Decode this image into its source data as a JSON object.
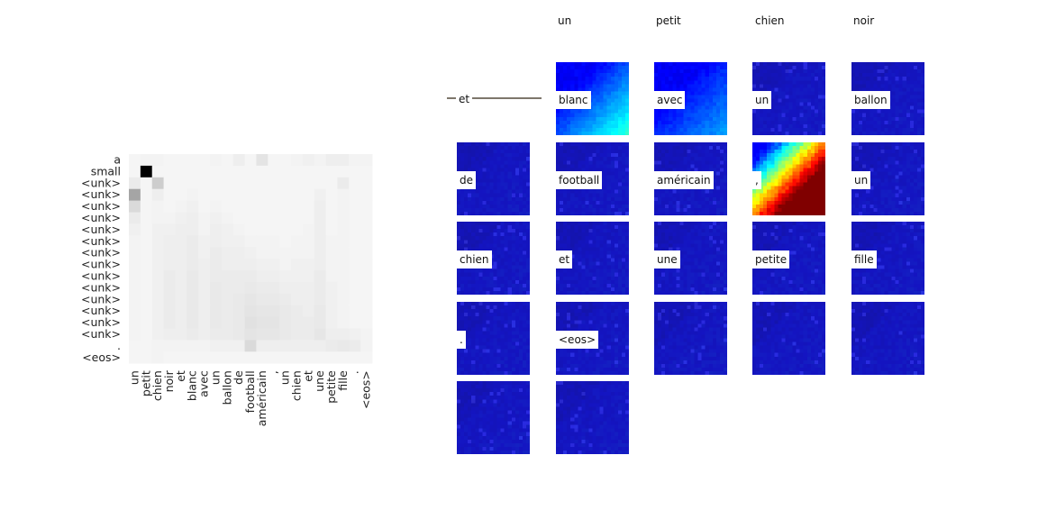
{
  "chart_data": [
    {
      "type": "heatmap",
      "title": "",
      "y_tokens": [
        "a",
        "small",
        "<unk>",
        "<unk>",
        "<unk>",
        "<unk>",
        "<unk>",
        "<unk>",
        "<unk>",
        "<unk>",
        "<unk>",
        "<unk>",
        "<unk>",
        "<unk>",
        "<unk>",
        "<unk>",
        ".",
        "<eos>"
      ],
      "x_tokens": [
        "un",
        "petit",
        "chien",
        "noir",
        "et",
        "blanc",
        "avec",
        "un",
        "ballon",
        "de",
        "football",
        "américain",
        ",",
        "un",
        "chien",
        "et",
        "une",
        "petite",
        "fille",
        ".",
        "<eos>"
      ],
      "colormap": "greys",
      "value_range": [
        0,
        1
      ],
      "values": [
        [
          0.02,
          0.03,
          0.03,
          0.02,
          0.02,
          0.02,
          0.02,
          0.03,
          0.02,
          0.05,
          0.02,
          0.09,
          0.02,
          0.02,
          0.03,
          0.04,
          0.03,
          0.05,
          0.05,
          0.03,
          0.03
        ],
        [
          0.02,
          1.0,
          0.02,
          0.02,
          0.02,
          0.02,
          0.02,
          0.02,
          0.02,
          0.02,
          0.02,
          0.02,
          0.02,
          0.02,
          0.02,
          0.02,
          0.02,
          0.02,
          0.02,
          0.02,
          0.02
        ],
        [
          0.06,
          0.02,
          0.18,
          0.02,
          0.02,
          0.02,
          0.02,
          0.02,
          0.02,
          0.02,
          0.02,
          0.02,
          0.02,
          0.02,
          0.02,
          0.02,
          0.02,
          0.02,
          0.06,
          0.02,
          0.02
        ],
        [
          0.34,
          0.02,
          0.05,
          0.02,
          0.02,
          0.03,
          0.02,
          0.02,
          0.02,
          0.02,
          0.02,
          0.02,
          0.02,
          0.02,
          0.02,
          0.02,
          0.04,
          0.02,
          0.03,
          0.02,
          0.02
        ],
        [
          0.13,
          0.02,
          0.03,
          0.02,
          0.03,
          0.04,
          0.02,
          0.03,
          0.02,
          0.02,
          0.02,
          0.02,
          0.02,
          0.02,
          0.02,
          0.02,
          0.05,
          0.02,
          0.03,
          0.02,
          0.02
        ],
        [
          0.06,
          0.02,
          0.03,
          0.03,
          0.04,
          0.05,
          0.03,
          0.04,
          0.03,
          0.02,
          0.02,
          0.02,
          0.02,
          0.02,
          0.02,
          0.02,
          0.05,
          0.02,
          0.03,
          0.02,
          0.02
        ],
        [
          0.04,
          0.02,
          0.04,
          0.04,
          0.05,
          0.05,
          0.03,
          0.05,
          0.04,
          0.03,
          0.02,
          0.02,
          0.02,
          0.02,
          0.02,
          0.03,
          0.05,
          0.02,
          0.03,
          0.02,
          0.02
        ],
        [
          0.03,
          0.02,
          0.04,
          0.05,
          0.05,
          0.06,
          0.04,
          0.05,
          0.04,
          0.04,
          0.03,
          0.03,
          0.03,
          0.02,
          0.03,
          0.03,
          0.05,
          0.03,
          0.03,
          0.02,
          0.02
        ],
        [
          0.03,
          0.02,
          0.04,
          0.05,
          0.05,
          0.06,
          0.04,
          0.06,
          0.05,
          0.05,
          0.04,
          0.03,
          0.03,
          0.03,
          0.03,
          0.03,
          0.05,
          0.03,
          0.03,
          0.02,
          0.02
        ],
        [
          0.03,
          0.02,
          0.04,
          0.05,
          0.05,
          0.06,
          0.05,
          0.06,
          0.05,
          0.05,
          0.05,
          0.04,
          0.04,
          0.03,
          0.04,
          0.04,
          0.05,
          0.03,
          0.03,
          0.02,
          0.02
        ],
        [
          0.03,
          0.02,
          0.04,
          0.06,
          0.05,
          0.07,
          0.05,
          0.06,
          0.06,
          0.06,
          0.06,
          0.05,
          0.05,
          0.04,
          0.04,
          0.04,
          0.06,
          0.03,
          0.03,
          0.02,
          0.02
        ],
        [
          0.03,
          0.02,
          0.04,
          0.06,
          0.05,
          0.07,
          0.05,
          0.07,
          0.06,
          0.06,
          0.07,
          0.06,
          0.06,
          0.05,
          0.05,
          0.05,
          0.06,
          0.04,
          0.03,
          0.02,
          0.02
        ],
        [
          0.03,
          0.02,
          0.04,
          0.06,
          0.05,
          0.07,
          0.05,
          0.07,
          0.06,
          0.07,
          0.08,
          0.07,
          0.07,
          0.06,
          0.05,
          0.05,
          0.06,
          0.04,
          0.03,
          0.02,
          0.02
        ],
        [
          0.03,
          0.02,
          0.04,
          0.06,
          0.05,
          0.07,
          0.05,
          0.07,
          0.06,
          0.07,
          0.09,
          0.08,
          0.08,
          0.07,
          0.06,
          0.05,
          0.07,
          0.04,
          0.03,
          0.02,
          0.02
        ],
        [
          0.03,
          0.02,
          0.04,
          0.06,
          0.05,
          0.07,
          0.05,
          0.07,
          0.06,
          0.07,
          0.1,
          0.09,
          0.09,
          0.07,
          0.06,
          0.06,
          0.07,
          0.04,
          0.03,
          0.02,
          0.02
        ],
        [
          0.03,
          0.02,
          0.04,
          0.05,
          0.05,
          0.06,
          0.05,
          0.06,
          0.06,
          0.07,
          0.09,
          0.08,
          0.08,
          0.07,
          0.06,
          0.06,
          0.08,
          0.05,
          0.05,
          0.04,
          0.03
        ],
        [
          0.02,
          0.02,
          0.03,
          0.03,
          0.03,
          0.03,
          0.03,
          0.04,
          0.04,
          0.04,
          0.13,
          0.05,
          0.05,
          0.05,
          0.05,
          0.05,
          0.05,
          0.06,
          0.07,
          0.06,
          0.03
        ],
        [
          0.02,
          0.02,
          0.03,
          0.02,
          0.02,
          0.02,
          0.02,
          0.02,
          0.02,
          0.02,
          0.02,
          0.02,
          0.02,
          0.02,
          0.02,
          0.02,
          0.02,
          0.02,
          0.02,
          0.02,
          0.02
        ]
      ]
    },
    {
      "type": "heatmap",
      "title": "",
      "colormap": "jet",
      "column_headers": [
        "un",
        "petit",
        "chien",
        "noir"
      ],
      "grid": [
        [
          {
            "label": "et",
            "pattern": "flat"
          },
          {
            "label": "blanc",
            "pattern": "corner-light"
          },
          {
            "label": "avec",
            "pattern": "corner-soft"
          },
          {
            "label": "un",
            "pattern": "flat"
          },
          {
            "label": "ballon",
            "pattern": "flat"
          }
        ],
        [
          {
            "label": "de",
            "pattern": "flat"
          },
          {
            "label": "football",
            "pattern": "flat"
          },
          {
            "label": "américain",
            "pattern": "flat"
          },
          {
            "label": ",",
            "pattern": "corner-hot"
          },
          {
            "label": "un",
            "pattern": "flat"
          }
        ],
        [
          {
            "label": "chien",
            "pattern": "flat"
          },
          {
            "label": "et",
            "pattern": "flat"
          },
          {
            "label": "une",
            "pattern": "flat"
          },
          {
            "label": "petite",
            "pattern": "flat"
          },
          {
            "label": "fille",
            "pattern": "flat"
          }
        ],
        [
          {
            "label": ".",
            "pattern": "flat"
          },
          {
            "label": "<eos>",
            "pattern": "flat"
          },
          {
            "label": "",
            "pattern": "flat"
          },
          {
            "label": "",
            "pattern": "flat"
          },
          {
            "label": "",
            "pattern": "flat"
          }
        ],
        [
          {
            "label": "",
            "pattern": "flat"
          },
          {
            "label": "",
            "pattern": "flat"
          }
        ]
      ]
    }
  ]
}
